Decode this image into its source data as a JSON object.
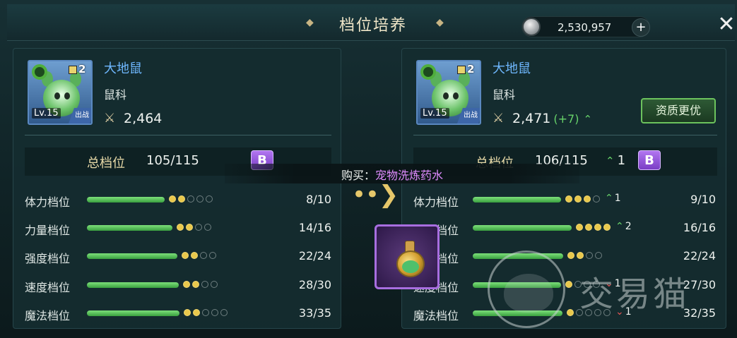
{
  "header": {
    "title": "档位培养",
    "currency_amount": "2,530,957",
    "currency_icon": "silver-coin-icon",
    "add_label": "+",
    "close_label": "✕"
  },
  "left_pet": {
    "name": "大地鼠",
    "family": "鼠科",
    "grade_num": "2",
    "level": "Lv.15",
    "deploy_tag": "出战",
    "power": "2,464",
    "total_label": "总档位",
    "total_value": "105/115",
    "grade": "B",
    "stats": [
      {
        "label": "体力档位",
        "value": "8/10",
        "bar_fraction": 0.8,
        "dots_on": 2,
        "dots_total": 5
      },
      {
        "label": "力量档位",
        "value": "14/16",
        "bar_fraction": 0.875,
        "dots_on": 2,
        "dots_total": 4
      },
      {
        "label": "强度档位",
        "value": "22/24",
        "bar_fraction": 0.917,
        "dots_on": 2,
        "dots_total": 4
      },
      {
        "label": "速度档位",
        "value": "28/30",
        "bar_fraction": 0.933,
        "dots_on": 2,
        "dots_total": 4
      },
      {
        "label": "魔法档位",
        "value": "33/35",
        "bar_fraction": 0.943,
        "dots_on": 2,
        "dots_total": 5
      }
    ]
  },
  "right_pet": {
    "name": "大地鼠",
    "family": "鼠科",
    "grade_num": "2",
    "level": "Lv.15",
    "deploy_tag": "出战",
    "power": "2,471",
    "power_delta": "(+7)",
    "quality_button": "资质更优",
    "total_label": "总档位",
    "total_value": "106/115",
    "total_change": "1",
    "grade": "B",
    "stats": [
      {
        "label": "体力档位",
        "value": "9/10",
        "bar_fraction": 0.9,
        "dots_on": 3,
        "dots_total": 4,
        "change": "1",
        "direction": "up"
      },
      {
        "label": "力量档位",
        "value": "16/16",
        "bar_fraction": 1.0,
        "dots_on": 4,
        "dots_total": 4,
        "change": "2",
        "direction": "up"
      },
      {
        "label": "强度档位",
        "value": "22/24",
        "bar_fraction": 0.917,
        "dots_on": 2,
        "dots_total": 4,
        "change": "",
        "direction": ""
      },
      {
        "label": "速度档位",
        "value": "27/30",
        "bar_fraction": 0.9,
        "dots_on": 1,
        "dots_total": 4,
        "change": "1",
        "direction": "down"
      },
      {
        "label": "魔法档位",
        "value": "32/35",
        "bar_fraction": 0.914,
        "dots_on": 1,
        "dots_total": 5,
        "change": "1",
        "direction": "down"
      }
    ]
  },
  "buy": {
    "prefix": "购买：",
    "item_name": "宠物洗炼药水"
  },
  "watermark": {
    "text": "交易猫"
  },
  "colors": {
    "accent_green": "#67d36a",
    "down_red": "#e85454",
    "pet_name_blue": "#6fb8ff",
    "grade_purple": "#9b5fe0",
    "potion_name": "#e08cff"
  }
}
